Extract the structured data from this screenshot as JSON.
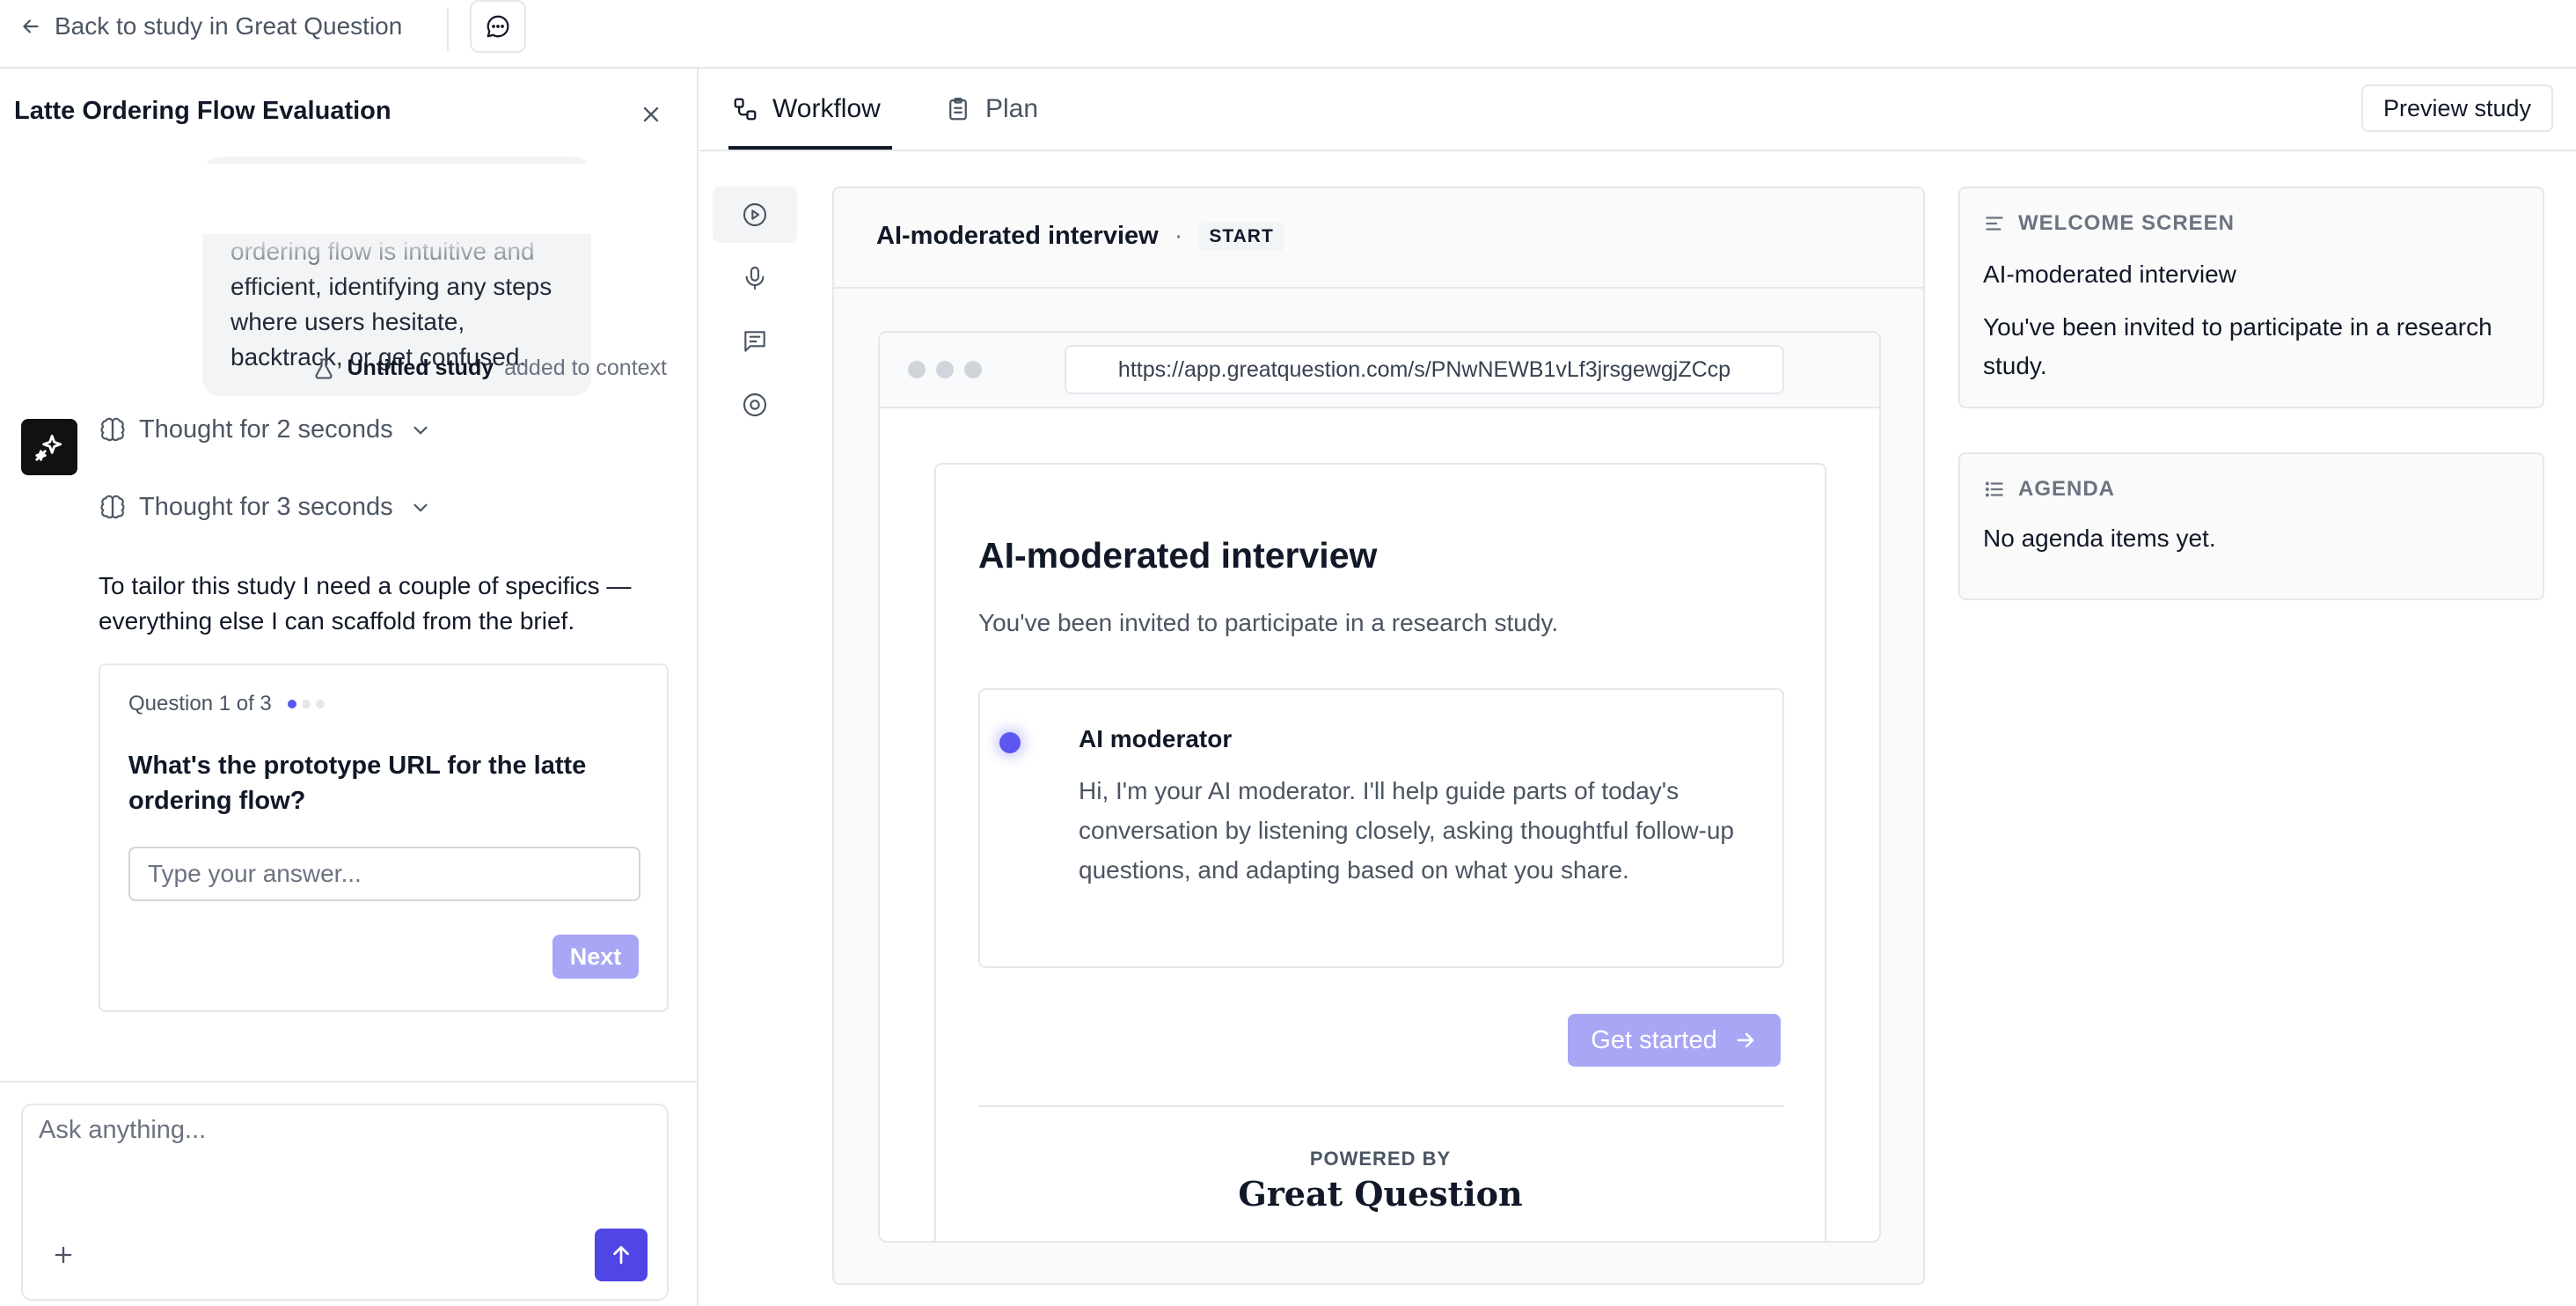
{
  "topbar": {
    "back_label": "Back to study in Great Question",
    "icons": {
      "back": "arrow-left-icon",
      "chat": "chat-bubble-icon"
    }
  },
  "left_panel": {
    "study_title": "Latte Ordering Flow Evaluation",
    "user_message_visible": "ordering flow is intuitive and efficient, identifying any steps where users hesitate, backtrack, or get confused.",
    "context": {
      "study_name": "Untitled study",
      "suffix": "added to context"
    },
    "thoughts": [
      {
        "label": "Thought for 2 seconds"
      },
      {
        "label": "Thought for 3 seconds"
      }
    ],
    "assistant_message": "To tailor this study I need a couple of specifics — everything else I can scaffold from the brief.",
    "question_card": {
      "counter": "Question 1 of 3",
      "total_steps": 3,
      "current_step": 1,
      "question": "What's the prototype URL for the latte ordering flow?",
      "answer_placeholder": "Type your answer...",
      "next_label": "Next"
    },
    "composer": {
      "placeholder": "Ask anything..."
    }
  },
  "tabs": [
    {
      "label": "Workflow",
      "icon": "workflow-icon",
      "active": true
    },
    {
      "label": "Plan",
      "icon": "clipboard-icon",
      "active": false
    }
  ],
  "preview_label": "Preview study",
  "step_rail": [
    {
      "icon": "play-circle-icon",
      "active": true
    },
    {
      "icon": "microphone-icon",
      "active": false
    },
    {
      "icon": "message-square-icon",
      "active": false
    },
    {
      "icon": "stop-circle-icon",
      "active": false
    }
  ],
  "center": {
    "title": "AI-moderated interview",
    "separator": "·",
    "badge": "START",
    "browser_url": "https://app.greatquestion.com/s/PNwNEWB1vLf3jrsgewgjZCcp",
    "preview": {
      "title": "AI-moderated interview",
      "subtitle": "You've been invited to participate in a research study.",
      "moderator_name": "AI moderator",
      "moderator_text": "Hi, I'm your AI moderator. I'll help guide parts of today's conversation by listening closely, asking thoughtful follow-up questions, and adapting based on what you share.",
      "cta_label": "Get started",
      "powered_by": "POWERED BY",
      "brand": "Great Question"
    }
  },
  "welcome_screen": {
    "label": "WELCOME SCREEN",
    "title": "AI-moderated interview",
    "body": "You've been invited to participate in a research study."
  },
  "agenda": {
    "label": "AGENDA",
    "empty_text": "No agenda items yet."
  },
  "colors": {
    "accent": "#4f46e5",
    "accent_disabled": "#a9a6f6",
    "border": "#e5e7eb",
    "text_muted": "#6b7280"
  }
}
